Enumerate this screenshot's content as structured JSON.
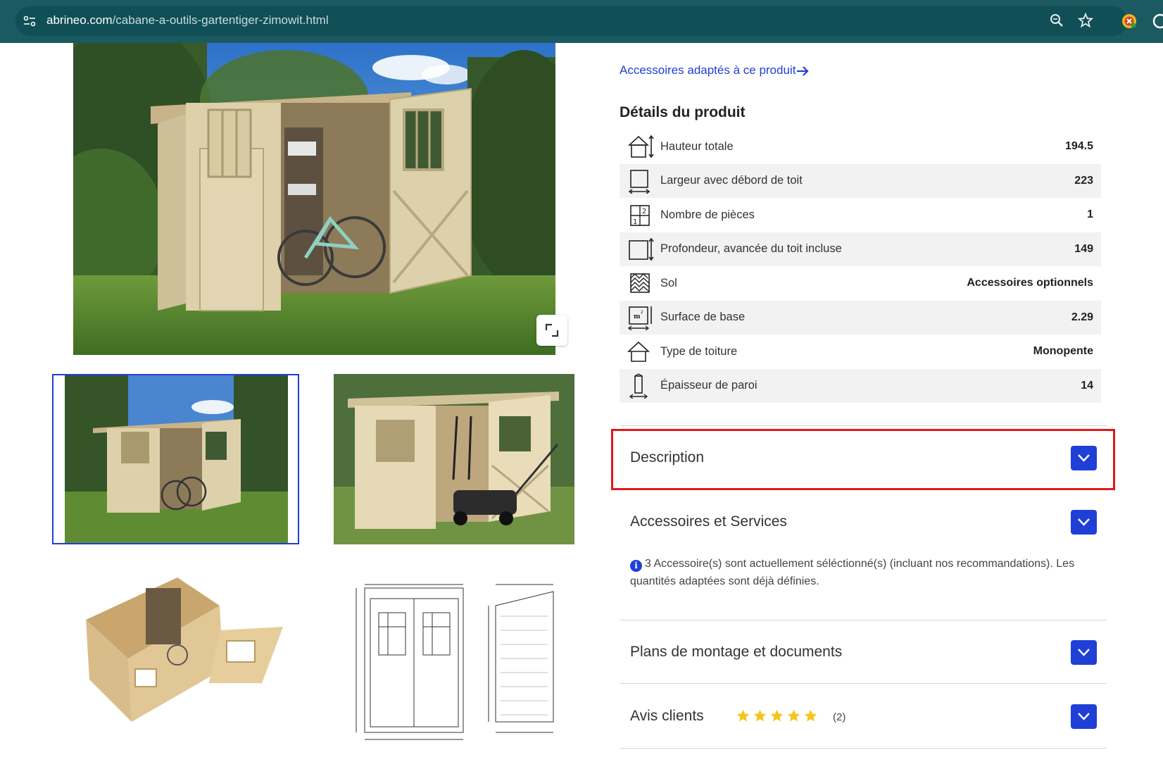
{
  "browser": {
    "url_domain": "abrineo.com",
    "url_path": "/cabane-a-outils-gartentiger-zimowit.html"
  },
  "product": {
    "accessories_link": "Accessoires adaptés à ce produit",
    "details_title": "Détails du produit",
    "details": [
      {
        "icon": "height-house-icon",
        "label": "Hauteur totale",
        "value": "194.5"
      },
      {
        "icon": "width-box-icon",
        "label": "Largeur avec débord de toit",
        "value": "223"
      },
      {
        "icon": "room-count-icon",
        "label": "Nombre de pièces",
        "value": "1"
      },
      {
        "icon": "depth-box-icon",
        "label": "Profondeur, avancée du toit incluse",
        "value": "149"
      },
      {
        "icon": "floor-pattern-icon",
        "label": "Sol",
        "value": "Accessoires optionnels"
      },
      {
        "icon": "area-m2-icon",
        "label": "Surface de base",
        "value": "2.29"
      },
      {
        "icon": "roof-type-icon",
        "label": "Type de toiture",
        "value": "Monopente"
      },
      {
        "icon": "wall-thickness-icon",
        "label": "Épaisseur de paroi",
        "value": "14"
      }
    ]
  },
  "sections": {
    "description": "Description",
    "accessories": "Accessoires et Services",
    "accessories_info": "3 Accessoire(s) sont actuellement séléctionné(s) (incluant nos recommandations). Les quantités adaptées sont déjà définies.",
    "plans": "Plans de montage et documents",
    "reviews": "Avis clients",
    "reviews_rating": 5,
    "reviews_count": "(2)"
  },
  "colors": {
    "accent": "#1f3fd6",
    "highlight": "#e0191b",
    "browser_bar": "#1a5a60"
  }
}
